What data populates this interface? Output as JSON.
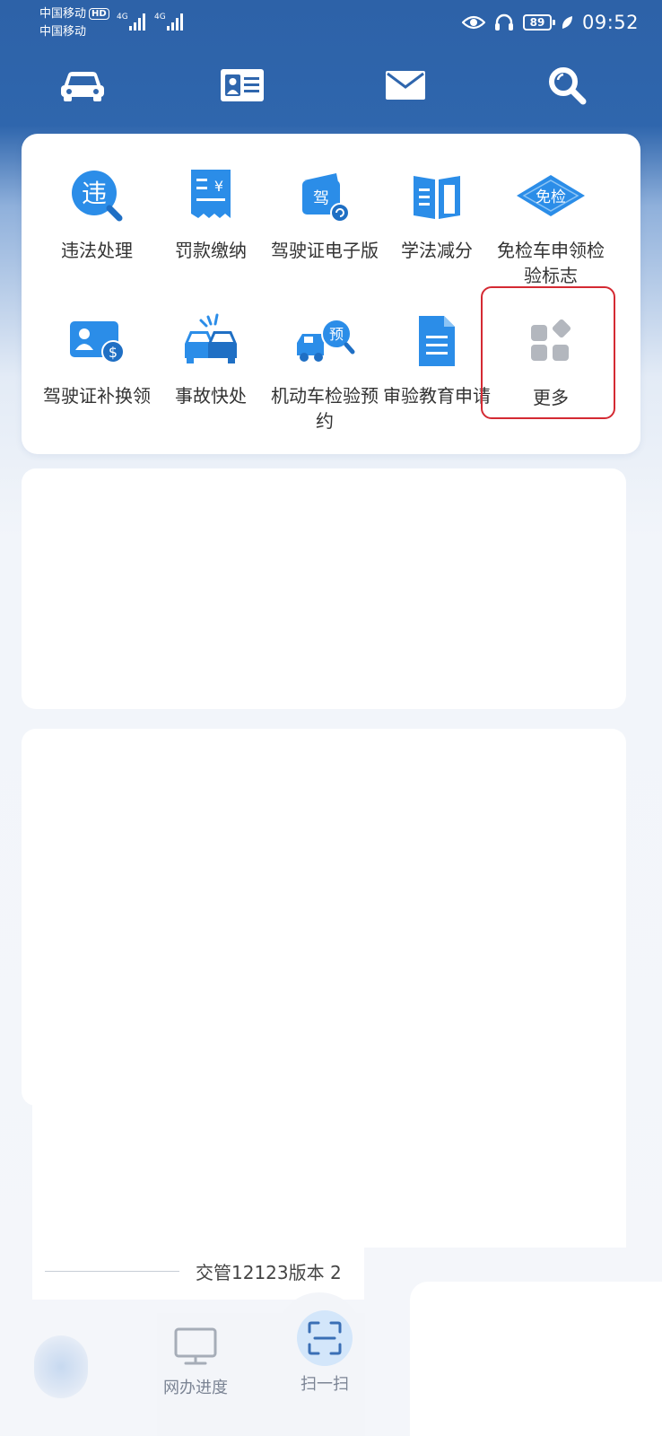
{
  "status_bar": {
    "carrier1": "中国移动",
    "hd": "HD",
    "carrier2": "中国移动",
    "network1": "4G",
    "network2": "4G",
    "battery": "89",
    "time": "09:52"
  },
  "top_nav": {
    "items": [
      {
        "name": "car-icon"
      },
      {
        "name": "id-card-icon"
      },
      {
        "name": "mail-icon"
      },
      {
        "name": "search-icon"
      }
    ]
  },
  "services": {
    "items": [
      {
        "label": "违法处理",
        "icon": "violation-icon",
        "glyph": "违"
      },
      {
        "label": "罚款缴纳",
        "icon": "fine-receipt-icon",
        "glyph": "¥"
      },
      {
        "label": "驾驶证电子版",
        "icon": "e-license-icon",
        "glyph": "驾"
      },
      {
        "label": "学法减分",
        "icon": "study-book-icon"
      },
      {
        "label": "免检车申领检验标志",
        "icon": "exempt-inspection-icon",
        "glyph": "免检"
      },
      {
        "label": "驾驶证补换领",
        "icon": "license-reissue-icon"
      },
      {
        "label": "事故快处",
        "icon": "accident-icon"
      },
      {
        "label": "机动车检验预约",
        "icon": "inspection-booking-icon",
        "glyph": "预"
      },
      {
        "label": "审验教育申请",
        "icon": "document-icon"
      },
      {
        "label": "更多",
        "icon": "more-grid-icon"
      }
    ]
  },
  "footer": {
    "version_text": "交管12123版本 2"
  },
  "tab_bar": {
    "items": [
      {
        "label": "网办进度",
        "icon": "monitor-icon"
      },
      {
        "label": "扫一扫",
        "icon": "scan-icon"
      }
    ]
  },
  "colors": {
    "header_blue": "#2d62a8",
    "icon_blue": "#2b8de8",
    "highlight_red": "#d42a33"
  }
}
